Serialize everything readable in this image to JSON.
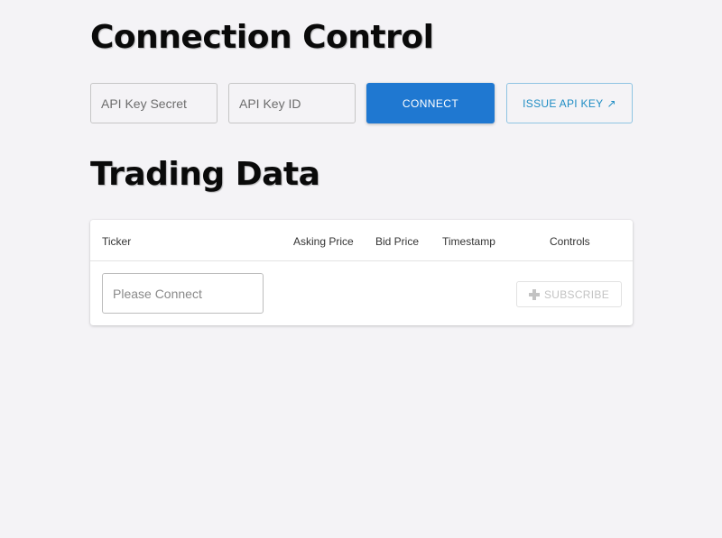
{
  "connection": {
    "title": "Connection Control",
    "secret_placeholder": "API Key Secret",
    "id_placeholder": "API Key ID",
    "connect_label": "CONNECT",
    "issue_label": "ISSUE API KEY",
    "issue_icon": "external-link-icon",
    "issue_glyph": "↗",
    "accent_color": "#1f78d1"
  },
  "trading": {
    "title": "Trading Data",
    "columns": [
      "Ticker",
      "Asking Price",
      "Bid Price",
      "Timestamp",
      "Controls"
    ],
    "ticker_placeholder": "Please Connect",
    "subscribe_label": "SUBSCRIBE",
    "subscribe_icon": "plus-icon",
    "subscribe_disabled": true
  }
}
